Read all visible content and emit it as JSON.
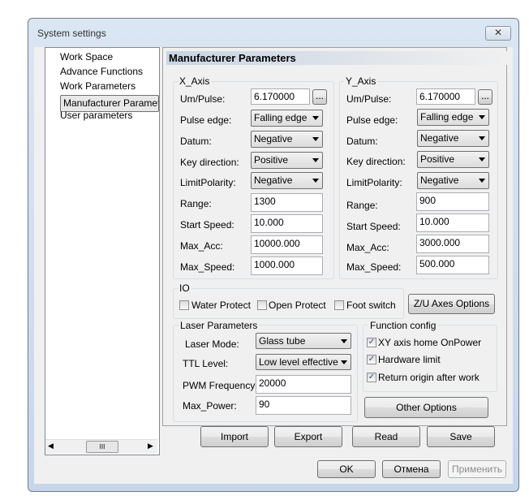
{
  "window": {
    "title": "System settings",
    "close_icon": "close-icon"
  },
  "tree": {
    "items": [
      "Work Space",
      "Advance Functions",
      "Work Parameters",
      "Manufacturer Paramet",
      "User parameters"
    ],
    "scroll_thumb": "III"
  },
  "panel": {
    "header": "Manufacturer Parameters"
  },
  "x_axis": {
    "title": "X_Axis",
    "um_pulse_label": "Um/Pulse:",
    "um_pulse": "6.170000",
    "browse": "...",
    "pulse_edge_label": "Pulse edge:",
    "pulse_edge": "Falling edge",
    "datum_label": "Datum:",
    "datum": "Negative",
    "key_dir_label": "Key direction:",
    "key_dir": "Positive",
    "limit_label": "LimitPolarity:",
    "limit": "Negative",
    "range_label": "Range:",
    "range": "1300",
    "start_label": "Start Speed:",
    "start": "10.000",
    "acc_label": "Max_Acc:",
    "acc": "10000.000",
    "speed_label": "Max_Speed:",
    "speed": "1000.000"
  },
  "y_axis": {
    "title": "Y_Axis",
    "um_pulse_label": "Um/Pulse:",
    "um_pulse": "6.170000",
    "browse": "...",
    "pulse_edge_label": "Pulse edge:",
    "pulse_edge": "Falling edge",
    "datum_label": "Datum:",
    "datum": "Negative",
    "key_dir_label": "Key direction:",
    "key_dir": "Positive",
    "limit_label": "LimitPolarity:",
    "limit": "Negative",
    "range_label": "Range:",
    "range": "900",
    "start_label": "Start Speed:",
    "start": "10.000",
    "acc_label": "Max_Acc:",
    "acc": "3000.000",
    "speed_label": "Max_Speed:",
    "speed": "500.000"
  },
  "io": {
    "title": "IO",
    "water": "Water Protect",
    "open": "Open Protect",
    "foot": "Foot switch",
    "zu_button": "Z/U Axes Options"
  },
  "laser": {
    "title": "Laser Parameters",
    "mode_label": "Laser Mode:",
    "mode": "Glass tube",
    "ttl_label": "TTL Level:",
    "ttl": "Low level effective",
    "pwm_label": "PWM Frequency:",
    "pwm": "20000",
    "power_label": "Max_Power:",
    "power": "90"
  },
  "func": {
    "title": "Function config",
    "xy_home": "XY axis home OnPower",
    "hw_limit": "Hardware limit",
    "return_origin": "Return origin after work",
    "other": "Other Options"
  },
  "actions": {
    "import": "Import",
    "export": "Export",
    "read": "Read",
    "save": "Save"
  },
  "footer": {
    "ok": "OK",
    "cancel": "Отмена",
    "apply": "Применить"
  }
}
